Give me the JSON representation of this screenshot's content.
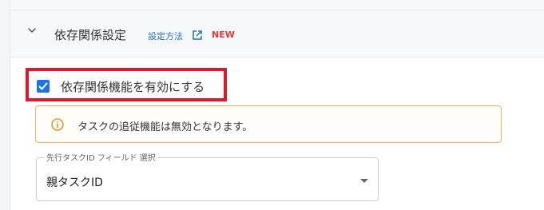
{
  "section": {
    "title": "依存関係設定",
    "howto_link": "設定方法",
    "badge": "NEW",
    "icons": {
      "chevron": "chevron-down-icon",
      "external": "external-link-icon"
    }
  },
  "dependency": {
    "checkbox_label": "依存関係機能を有効にする",
    "checked": true
  },
  "notice": {
    "icon": "info-icon",
    "text": "タスクの追従機能は無効となります。"
  },
  "predecessor_field": {
    "label": "先行タスクID フィールド 選択",
    "value": "親タスクID"
  },
  "colors": {
    "accent": "#1e74d8",
    "link": "#1a73c9",
    "badge": "#e53935",
    "warning_border": "#f5b255",
    "highlight": "#e0162b"
  }
}
